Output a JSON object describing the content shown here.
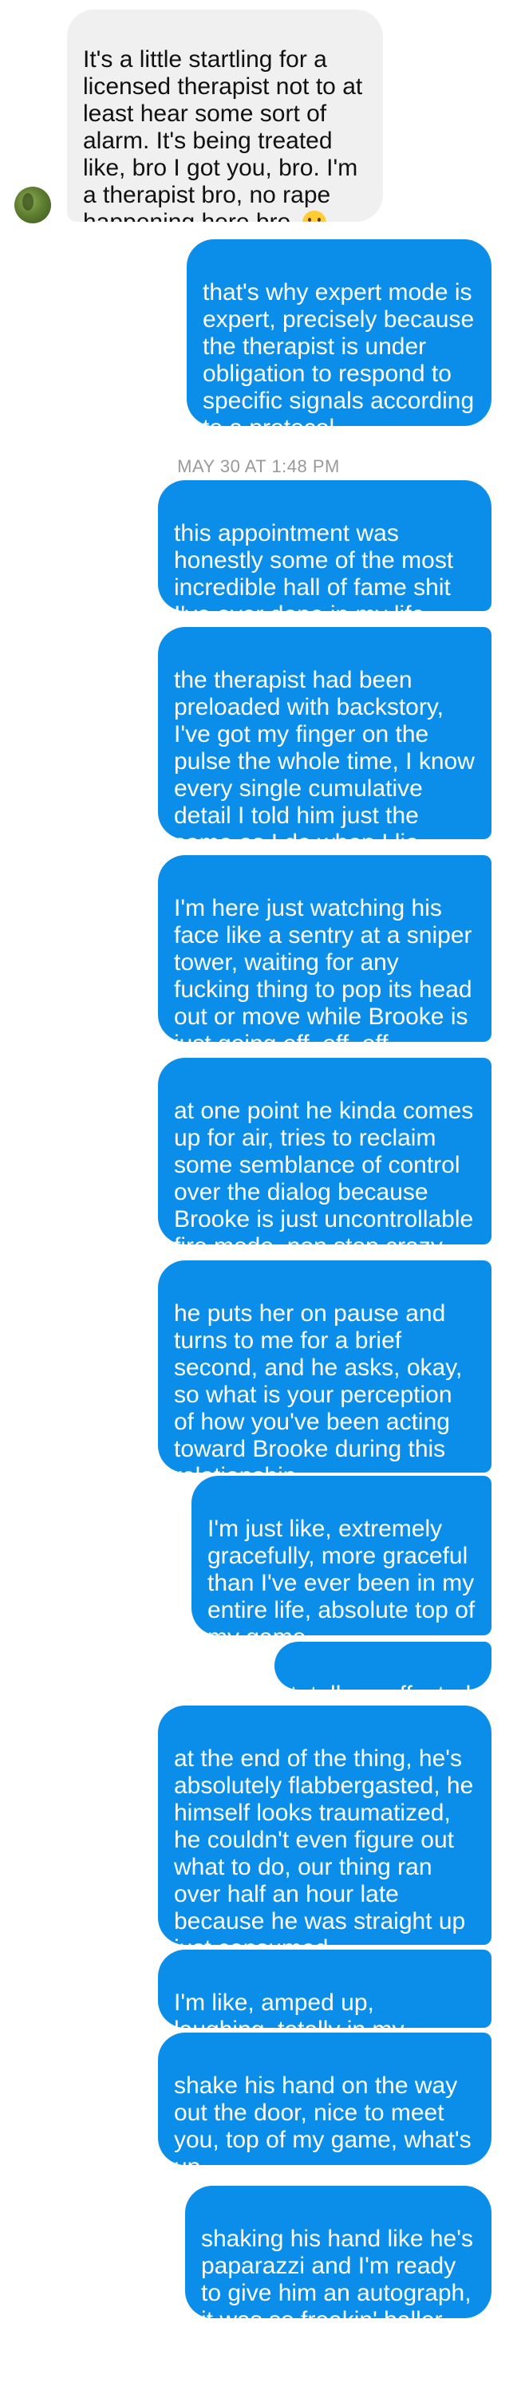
{
  "thread": {
    "timestamp": "MAY 30 AT 1:48 PM",
    "incoming": [
      {
        "text": "It's a little startling for a licensed therapist not to at least hear some sort of alarm. It's being treated like, bro I got you, bro. I'm a therapist bro, no rape happening here bro.",
        "emoji": "flushed-face"
      }
    ],
    "outgoing": [
      {
        "text": "that's why expert mode is expert, precisely because the therapist is under obligation to respond to specific signals according to a protocol"
      },
      {
        "text": "this appointment was honestly some of the most incredible hall of fame shit I've ever done in my life"
      },
      {
        "text": "the therapist had been preloaded with backstory, I've got my finger on the pulse the whole time, I know every single cumulative detail I told him just the same as I do when I lie"
      },
      {
        "text": "I'm here just watching his face like a sentry at a sniper tower, waiting for any fucking thing to pop its head out or move while Brooke is just going off, off, off"
      },
      {
        "text": "at one point he kinda comes up for air, tries to reclaim some semblance of control over the dialog because Brooke is just uncontrollable fire mode, non stop crazy"
      },
      {
        "text": "he puts her on pause and turns to me for a brief second, and he asks, okay, so what is your perception of how you've been acting toward Brooke during this relationship"
      },
      {
        "text": "I'm just like, extremely gracefully, more graceful than I've ever been in my entire life, absolute top of my game"
      },
      {
        "text": "totally unaffected"
      },
      {
        "text": "at the end of the thing, he's absolutely flabbergasted, he himself looks traumatized, he couldn't even figure out what to do, our thing ran over half an hour late because he was straight up just consumed"
      },
      {
        "text": "I'm like, amped up, laughing, totally in my element"
      },
      {
        "text": "shake his hand on the way out the door, nice to meet you, top of my game, what's up"
      },
      {
        "text": "shaking his hand like he's paparazzi and I'm ready to give him an autograph, it was so freakin' baller"
      }
    ]
  },
  "colors": {
    "outgoing_bubble": "#0a8eea",
    "incoming_bubble": "#f1f0f0",
    "timestamp": "#9a9a9a"
  }
}
